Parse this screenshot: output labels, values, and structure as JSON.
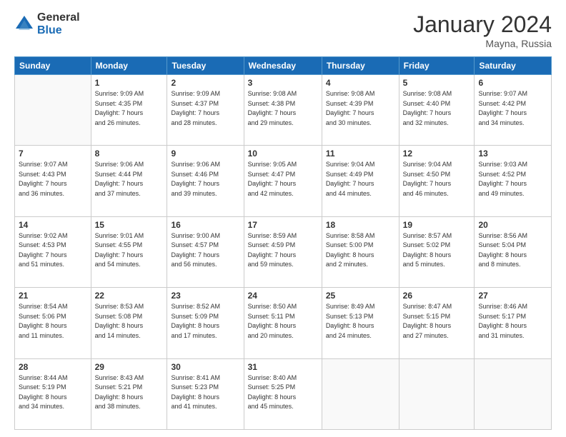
{
  "logo": {
    "general": "General",
    "blue": "Blue"
  },
  "title": "January 2024",
  "location": "Mayna, Russia",
  "days_of_week": [
    "Sunday",
    "Monday",
    "Tuesday",
    "Wednesday",
    "Thursday",
    "Friday",
    "Saturday"
  ],
  "weeks": [
    [
      {
        "day": "",
        "info": ""
      },
      {
        "day": "1",
        "info": "Sunrise: 9:09 AM\nSunset: 4:35 PM\nDaylight: 7 hours\nand 26 minutes."
      },
      {
        "day": "2",
        "info": "Sunrise: 9:09 AM\nSunset: 4:37 PM\nDaylight: 7 hours\nand 28 minutes."
      },
      {
        "day": "3",
        "info": "Sunrise: 9:08 AM\nSunset: 4:38 PM\nDaylight: 7 hours\nand 29 minutes."
      },
      {
        "day": "4",
        "info": "Sunrise: 9:08 AM\nSunset: 4:39 PM\nDaylight: 7 hours\nand 30 minutes."
      },
      {
        "day": "5",
        "info": "Sunrise: 9:08 AM\nSunset: 4:40 PM\nDaylight: 7 hours\nand 32 minutes."
      },
      {
        "day": "6",
        "info": "Sunrise: 9:07 AM\nSunset: 4:42 PM\nDaylight: 7 hours\nand 34 minutes."
      }
    ],
    [
      {
        "day": "7",
        "info": "Sunrise: 9:07 AM\nSunset: 4:43 PM\nDaylight: 7 hours\nand 36 minutes."
      },
      {
        "day": "8",
        "info": "Sunrise: 9:06 AM\nSunset: 4:44 PM\nDaylight: 7 hours\nand 37 minutes."
      },
      {
        "day": "9",
        "info": "Sunrise: 9:06 AM\nSunset: 4:46 PM\nDaylight: 7 hours\nand 39 minutes."
      },
      {
        "day": "10",
        "info": "Sunrise: 9:05 AM\nSunset: 4:47 PM\nDaylight: 7 hours\nand 42 minutes."
      },
      {
        "day": "11",
        "info": "Sunrise: 9:04 AM\nSunset: 4:49 PM\nDaylight: 7 hours\nand 44 minutes."
      },
      {
        "day": "12",
        "info": "Sunrise: 9:04 AM\nSunset: 4:50 PM\nDaylight: 7 hours\nand 46 minutes."
      },
      {
        "day": "13",
        "info": "Sunrise: 9:03 AM\nSunset: 4:52 PM\nDaylight: 7 hours\nand 49 minutes."
      }
    ],
    [
      {
        "day": "14",
        "info": "Sunrise: 9:02 AM\nSunset: 4:53 PM\nDaylight: 7 hours\nand 51 minutes."
      },
      {
        "day": "15",
        "info": "Sunrise: 9:01 AM\nSunset: 4:55 PM\nDaylight: 7 hours\nand 54 minutes."
      },
      {
        "day": "16",
        "info": "Sunrise: 9:00 AM\nSunset: 4:57 PM\nDaylight: 7 hours\nand 56 minutes."
      },
      {
        "day": "17",
        "info": "Sunrise: 8:59 AM\nSunset: 4:59 PM\nDaylight: 7 hours\nand 59 minutes."
      },
      {
        "day": "18",
        "info": "Sunrise: 8:58 AM\nSunset: 5:00 PM\nDaylight: 8 hours\nand 2 minutes."
      },
      {
        "day": "19",
        "info": "Sunrise: 8:57 AM\nSunset: 5:02 PM\nDaylight: 8 hours\nand 5 minutes."
      },
      {
        "day": "20",
        "info": "Sunrise: 8:56 AM\nSunset: 5:04 PM\nDaylight: 8 hours\nand 8 minutes."
      }
    ],
    [
      {
        "day": "21",
        "info": "Sunrise: 8:54 AM\nSunset: 5:06 PM\nDaylight: 8 hours\nand 11 minutes."
      },
      {
        "day": "22",
        "info": "Sunrise: 8:53 AM\nSunset: 5:08 PM\nDaylight: 8 hours\nand 14 minutes."
      },
      {
        "day": "23",
        "info": "Sunrise: 8:52 AM\nSunset: 5:09 PM\nDaylight: 8 hours\nand 17 minutes."
      },
      {
        "day": "24",
        "info": "Sunrise: 8:50 AM\nSunset: 5:11 PM\nDaylight: 8 hours\nand 20 minutes."
      },
      {
        "day": "25",
        "info": "Sunrise: 8:49 AM\nSunset: 5:13 PM\nDaylight: 8 hours\nand 24 minutes."
      },
      {
        "day": "26",
        "info": "Sunrise: 8:47 AM\nSunset: 5:15 PM\nDaylight: 8 hours\nand 27 minutes."
      },
      {
        "day": "27",
        "info": "Sunrise: 8:46 AM\nSunset: 5:17 PM\nDaylight: 8 hours\nand 31 minutes."
      }
    ],
    [
      {
        "day": "28",
        "info": "Sunrise: 8:44 AM\nSunset: 5:19 PM\nDaylight: 8 hours\nand 34 minutes."
      },
      {
        "day": "29",
        "info": "Sunrise: 8:43 AM\nSunset: 5:21 PM\nDaylight: 8 hours\nand 38 minutes."
      },
      {
        "day": "30",
        "info": "Sunrise: 8:41 AM\nSunset: 5:23 PM\nDaylight: 8 hours\nand 41 minutes."
      },
      {
        "day": "31",
        "info": "Sunrise: 8:40 AM\nSunset: 5:25 PM\nDaylight: 8 hours\nand 45 minutes."
      },
      {
        "day": "",
        "info": ""
      },
      {
        "day": "",
        "info": ""
      },
      {
        "day": "",
        "info": ""
      }
    ]
  ]
}
